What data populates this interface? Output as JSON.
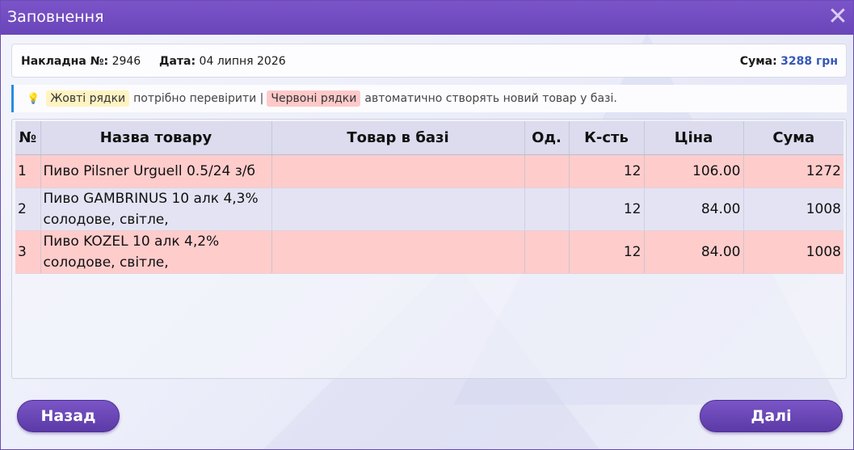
{
  "window": {
    "title": "Заповнення",
    "close_glyph": "✕"
  },
  "invoice": {
    "number_label": "Накладна №:",
    "number_value": "2946",
    "date_label": "Дата:",
    "date_value": "04 липня 2026",
    "sum_label": "Сума:",
    "sum_value": "3288 грн"
  },
  "hint": {
    "icon": "lightbulb-icon",
    "yellow_tag": "Жовті рядки",
    "text1": "потрібно перевірити |",
    "red_tag": "Червоні рядки",
    "text2": "автоматично створять новий товар у базі."
  },
  "table": {
    "columns": [
      "№",
      "Назва товару",
      "Товар в базі",
      "Од.",
      "К-сть",
      "Ціна",
      "Сума"
    ],
    "rows": [
      {
        "no": "1",
        "name": "Пиво Pilsner Urguell 0.5/24 з/б",
        "db_item": "",
        "unit": "",
        "qty": "12",
        "price": "106.00",
        "sum": "1272",
        "status": "red"
      },
      {
        "no": "2",
        "name": "Пиво GAMBRINUS 10 алк 4,3% солодове, світле,",
        "db_item": "",
        "unit": "",
        "qty": "12",
        "price": "84.00",
        "sum": "1008",
        "status": "normal"
      },
      {
        "no": "3",
        "name": "Пиво KOZEL 10 алк 4,2% солодове, світле,",
        "db_item": "",
        "unit": "",
        "qty": "12",
        "price": "84.00",
        "sum": "1008",
        "status": "red"
      }
    ]
  },
  "buttons": {
    "back": "Назад",
    "next": "Далі"
  },
  "colors": {
    "title_bar": "#6a45b9",
    "red_row": "#ffcccc",
    "yellow_tag": "#fff3c2",
    "sum_accent": "#3557b8"
  }
}
